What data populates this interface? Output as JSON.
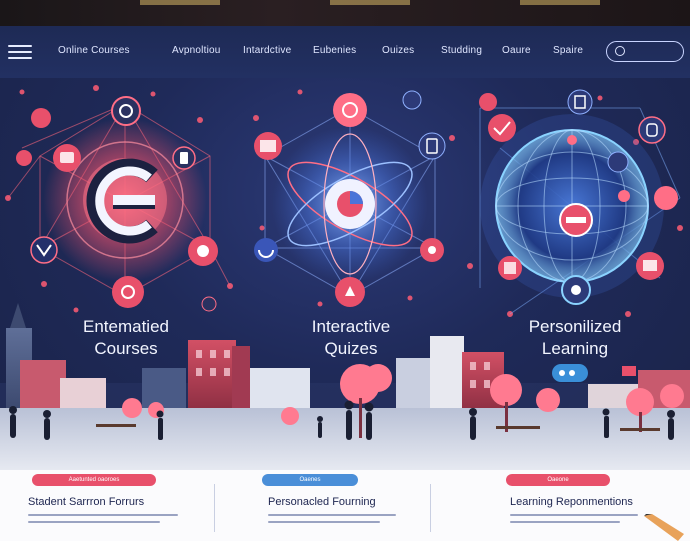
{
  "nav": {
    "links": [
      "Online Courses",
      "Avpnoltiou",
      "Intardctive",
      "Eubenies",
      "Ouizes",
      "Studding",
      "Oaure",
      "Spaire"
    ]
  },
  "hero": {
    "captions": [
      {
        "line1": "Entematied",
        "line2": "Courses"
      },
      {
        "line1": "Interactive",
        "line2": "Quizes"
      },
      {
        "line1": "Personilized",
        "line2": "Learning"
      }
    ]
  },
  "panels": [
    {
      "pill": "Aaetunted oaoroes",
      "title": "Stadent Sarrron Forrurs",
      "pill_color": "#e8506b"
    },
    {
      "pill": "Oaenes",
      "title": "Personacled Fourning",
      "pill_color": "#4a8ed8"
    },
    {
      "pill": "Oaeone",
      "title": "Learning Reponmentions",
      "pill_color": "#e8506b"
    }
  ],
  "colors": {
    "accent_red": "#e8506b",
    "accent_blue": "#4a8ed8",
    "nav_bg": "#223062"
  }
}
